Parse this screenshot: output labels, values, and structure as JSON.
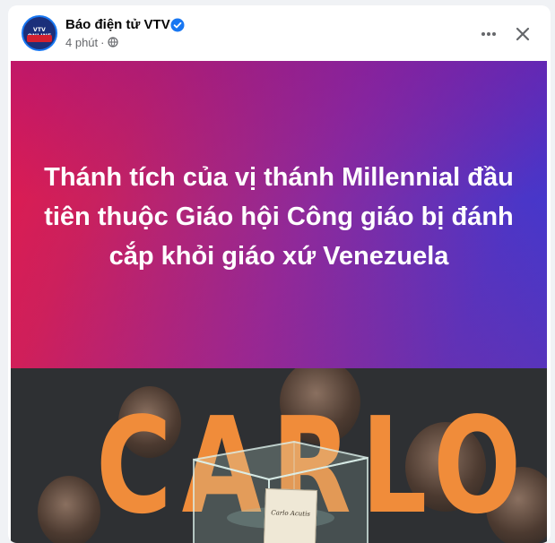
{
  "post": {
    "page_name": "Báo điện tử VTV",
    "time": "4 phút",
    "separator": "·",
    "avatar_logo_text": "VTV ONLINE"
  },
  "banner": {
    "headline": "Thánh tích của vị thánh Millennial đầu tiên thuộc Giáo hội Công giáo bị đánh cắp khỏi giáo xứ Venezuela",
    "gradient_colors": [
      "#e8194a",
      "#8a2a9e",
      "#3a3ad2"
    ]
  },
  "photo": {
    "name_letters": "CARLO",
    "name_color": "#f08c3a",
    "card_line1": "Carlo Acutis"
  },
  "icons": {
    "verified": "verified-badge-icon",
    "audience": "globe-icon",
    "more": "more-horizontal-icon",
    "close": "close-icon"
  },
  "colors": {
    "accent": "#1877f2",
    "text_primary": "#050505",
    "text_secondary": "#65676b"
  }
}
